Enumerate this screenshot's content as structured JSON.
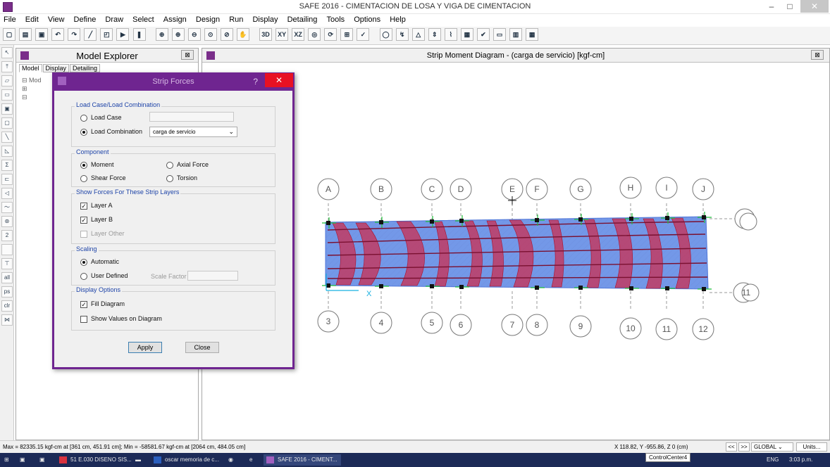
{
  "window": {
    "title": "SAFE 2016 - CIMENTACION DE LOSA Y VIGA DE CIMENTACION",
    "minimize": "–",
    "maximize": "□",
    "close": "✕"
  },
  "menu": [
    "File",
    "Edit",
    "View",
    "Define",
    "Draw",
    "Select",
    "Assign",
    "Design",
    "Run",
    "Display",
    "Detailing",
    "Tools",
    "Options",
    "Help"
  ],
  "toolbar": {
    "icons": [
      "new-model",
      "open",
      "save",
      "undo",
      "redo",
      "draw-line",
      "snap",
      "run",
      "pause",
      "zoom-window",
      "zoom-in",
      "zoom-out",
      "zoom-restore",
      "zoom-previous",
      "pan",
      "3d-view",
      "xy-view",
      "xz-view",
      "perspective",
      "refresh",
      "display-options",
      "show-undeformed",
      "deformed-shape",
      "reactions",
      "strip-forces",
      "slab-forces",
      "beam-forces",
      "tendons",
      "set-display",
      "grid",
      "table",
      "print"
    ],
    "labels": [
      "3D",
      "XY",
      "XZ"
    ]
  },
  "explorer": {
    "title": "Model Explorer",
    "close": "⊠",
    "tabs": [
      "Model",
      "Display",
      "Detailing"
    ],
    "tree": [
      "⊟ Mod",
      "  ⊞",
      "  ⊟"
    ]
  },
  "diagram": {
    "title": "Strip Moment Diagram  - (carga de servicio)  [kgf-cm]",
    "close": "⊠",
    "grid_top": [
      "A",
      "B",
      "C",
      "D",
      "E",
      "F",
      "G",
      "H",
      "I",
      "J"
    ],
    "grid_bottom": [
      "3",
      "4",
      "5",
      "6",
      "7",
      "8",
      "9",
      "10",
      "11",
      "12"
    ],
    "grid_right": [
      "",
      "11"
    ],
    "axis_label": "X"
  },
  "dialog": {
    "title": "Strip Forces",
    "help": "?",
    "close": "✕",
    "load_group": {
      "title": "Load Case/Load Combination",
      "load_case": "Load Case",
      "load_combination": "Load Combination",
      "combination_value": "carga de servicio",
      "selected": "load_combination"
    },
    "component_group": {
      "title": "Component",
      "moment": "Moment",
      "axial": "Axial Force",
      "shear": "Shear Force",
      "torsion": "Torsion",
      "selected": "moment"
    },
    "layers_group": {
      "title": "Show Forces For These Strip Layers",
      "layer_a": "Layer A",
      "layer_b": "Layer B",
      "layer_other": "Layer Other",
      "check_mark": "✓"
    },
    "scaling_group": {
      "title": "Scaling",
      "automatic": "Automatic",
      "user_defined": "User Defined",
      "scale_factor": "Scale Factor",
      "selected": "automatic"
    },
    "display_group": {
      "title": "Display Options",
      "fill_diagram": "Fill Diagram",
      "show_values": "Show Values on Diagram"
    },
    "apply": "Apply",
    "close_button": "Close"
  },
  "status": {
    "left": "Max = 82335.15 kgf-cm at [361 cm, 451.91 cm];  Min = -58581.67 kgf-cm at [2064 cm, 484.05 cm]",
    "coords": "X 118.82,  Y -955.86,  Z 0  (cm)",
    "prev": "<<",
    "next": ">>",
    "coord_system": "GLOBAL",
    "units": "Units..."
  },
  "taskbar": {
    "items": [
      "51 E.030 DISENO SIS...",
      "oscar memoria de c...",
      "SAFE 2016 - CIMENT..."
    ],
    "tooltip": "ControlCenter4",
    "lang": "ENG",
    "time": "3:03 p.m."
  },
  "colors": {
    "accent": "#6f2590",
    "fill_blue": "#4f7fdc",
    "fill_red": "#d81f3a",
    "strip_green": "#1fbf3a"
  }
}
